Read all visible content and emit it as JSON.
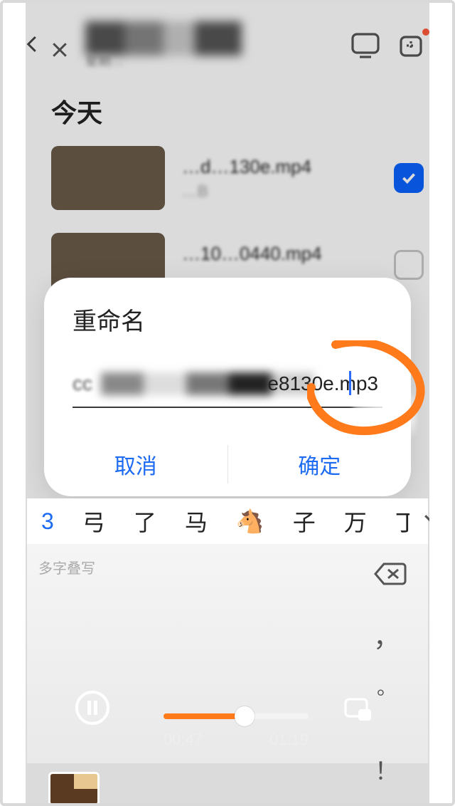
{
  "nav": {
    "subtitle": "星期…"
  },
  "section": {
    "today": "今天"
  },
  "files": [
    {
      "name": "…d…130e.mp4",
      "meta": "…B",
      "checked": true
    },
    {
      "name": "…10…0440.mp4",
      "meta": "…",
      "checked": false
    }
  ],
  "dialog": {
    "title": "重命名",
    "input_left": "cc",
    "input_right": "e8130e.mp3",
    "cancel": "取消",
    "confirm": "确定"
  },
  "candidates": {
    "items": [
      "3",
      "弓",
      "了",
      "马",
      "🐴",
      "子",
      "万",
      "丁"
    ]
  },
  "keyboard": {
    "hint": "多字叠写"
  },
  "side_keys": {
    "comma": "，",
    "dot": "。",
    "excl": "！"
  },
  "player": {
    "current": "00:47",
    "total": "01:19"
  }
}
